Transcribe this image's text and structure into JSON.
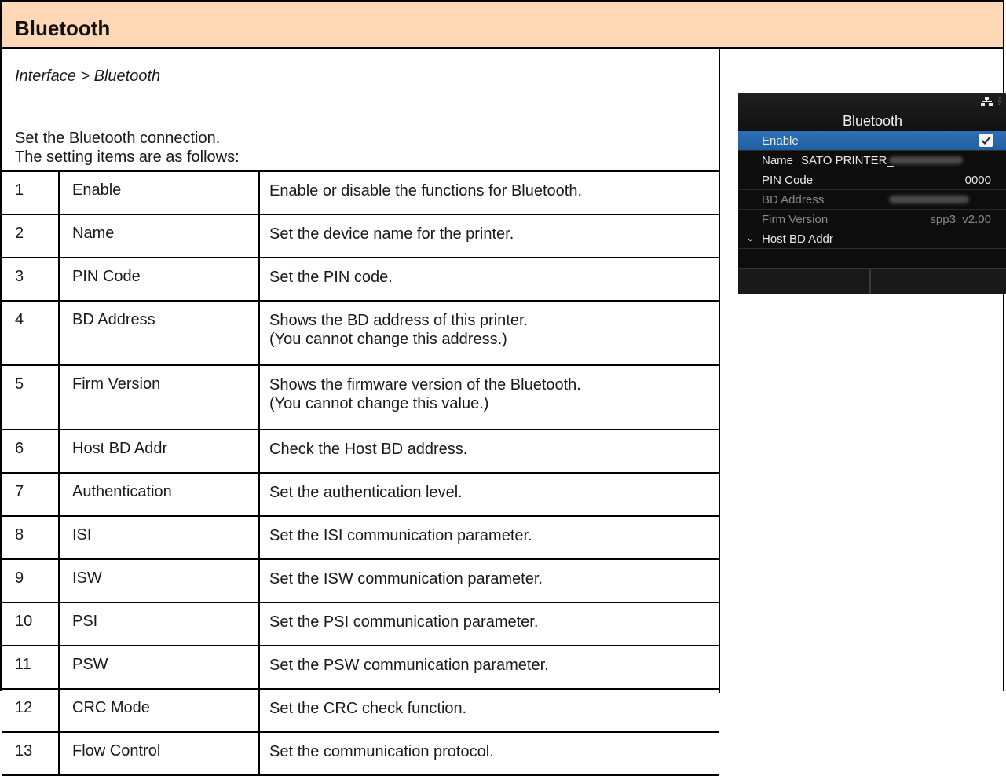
{
  "header": {
    "title": "Bluetooth"
  },
  "breadcrumb": "Interface > Bluetooth",
  "intro": {
    "line1": "Set the Bluetooth connection.",
    "line2": "The setting items are as follows:"
  },
  "items": [
    {
      "num": "1",
      "name": "Enable",
      "desc": [
        "Enable or disable the functions for Bluetooth."
      ]
    },
    {
      "num": "2",
      "name": "Name",
      "desc": [
        "Set the device name for the printer."
      ]
    },
    {
      "num": "3",
      "name": "PIN Code",
      "desc": [
        "Set the PIN code."
      ]
    },
    {
      "num": "4",
      "name": "BD Address",
      "desc": [
        "Shows the BD address of this printer.",
        "(You cannot change this address.)"
      ]
    },
    {
      "num": "5",
      "name": "Firm Version",
      "desc": [
        "Shows the firmware version of the Bluetooth.",
        "(You cannot change this value.)"
      ]
    },
    {
      "num": "6",
      "name": "Host BD Addr",
      "desc": [
        "Check the Host BD address."
      ]
    },
    {
      "num": "7",
      "name": "Authentication",
      "desc": [
        "Set the authentication level."
      ]
    },
    {
      "num": "8",
      "name": "ISI",
      "desc": [
        "Set the ISI communication parameter."
      ]
    },
    {
      "num": "9",
      "name": "ISW",
      "desc": [
        "Set the ISW communication parameter."
      ]
    },
    {
      "num": "10",
      "name": "PSI",
      "desc": [
        "Set the PSI communication parameter."
      ]
    },
    {
      "num": "11",
      "name": "PSW",
      "desc": [
        "Set the PSW communication parameter."
      ]
    },
    {
      "num": "12",
      "name": "CRC Mode",
      "desc": [
        "Set the CRC check function."
      ]
    },
    {
      "num": "13",
      "name": "Flow Control",
      "desc": [
        "Set the communication protocol."
      ]
    }
  ],
  "lcd": {
    "title": "Bluetooth",
    "rows": {
      "enable": {
        "label": "Enable"
      },
      "name": {
        "label": "Name",
        "value": "SATO PRINTER_"
      },
      "pin": {
        "label": "PIN Code",
        "value": "0000"
      },
      "bd": {
        "label": "BD Address"
      },
      "firm": {
        "label": "Firm Version",
        "value": "spp3_v2.00"
      },
      "host": {
        "label": "Host BD Addr"
      }
    },
    "colors": {
      "selected": "#1f5fa3",
      "background": "#0d0d0d"
    },
    "icons": [
      "network-icon",
      "bluetooth-icon",
      "checkbox-checked-icon",
      "chevron-down-icon"
    ]
  },
  "colors": {
    "title_bar": "#fdd7b6"
  }
}
